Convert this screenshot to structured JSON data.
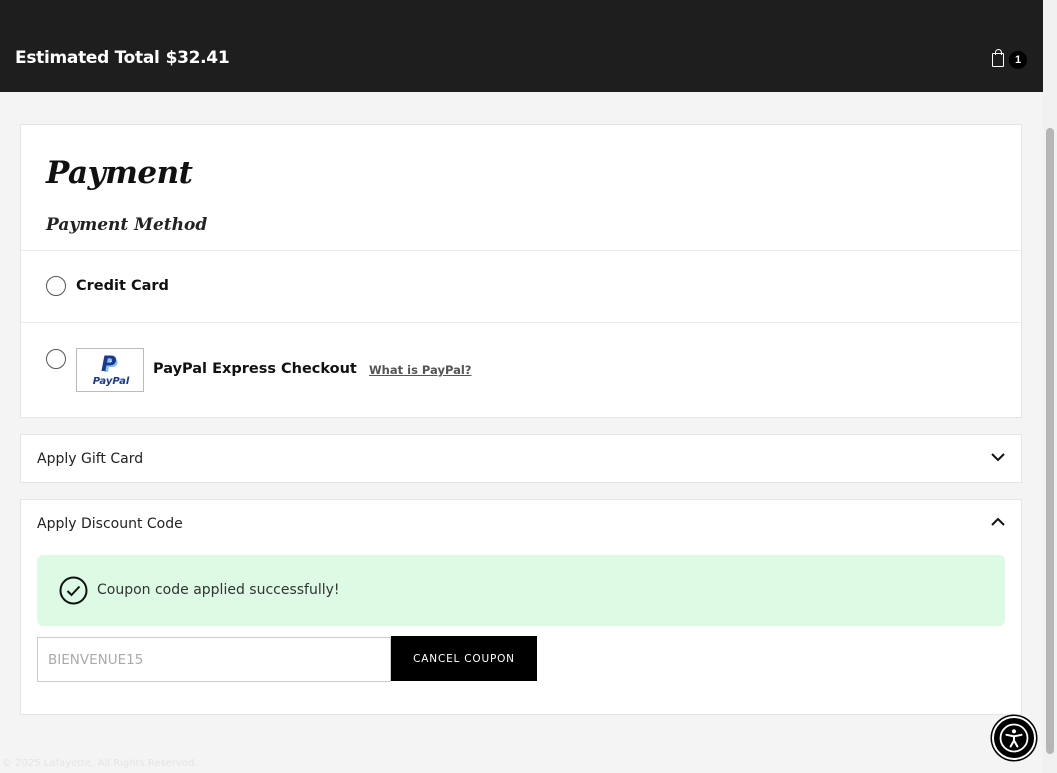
{
  "header": {
    "total_label": "Estimated Total",
    "total_value": "$32.41",
    "cart_count": "1",
    "icon": "shopping-bag-icon"
  },
  "payment": {
    "title": "Payment",
    "method_heading": "Payment Method",
    "options": [
      {
        "label": "Credit Card",
        "selected": false
      },
      {
        "label": "PayPal Express Checkout",
        "selected": false,
        "logo_text": "PayPal",
        "link": "What is PayPal?"
      }
    ]
  },
  "gift_card": {
    "title": "Apply Gift Card",
    "expanded": false
  },
  "discount": {
    "title": "Apply Discount Code",
    "expanded": true,
    "success_message": "Coupon code applied successfully!",
    "code_value": "BIENVENUE15",
    "cancel_label": "CANCEL COUPON"
  },
  "footer": {
    "copyright": "© 2025 Lafayette. All Rights Reserved."
  },
  "colors": {
    "header_bg": "#1e1e1e",
    "success_bg": "#dcfae4",
    "button_bg": "#000000"
  }
}
